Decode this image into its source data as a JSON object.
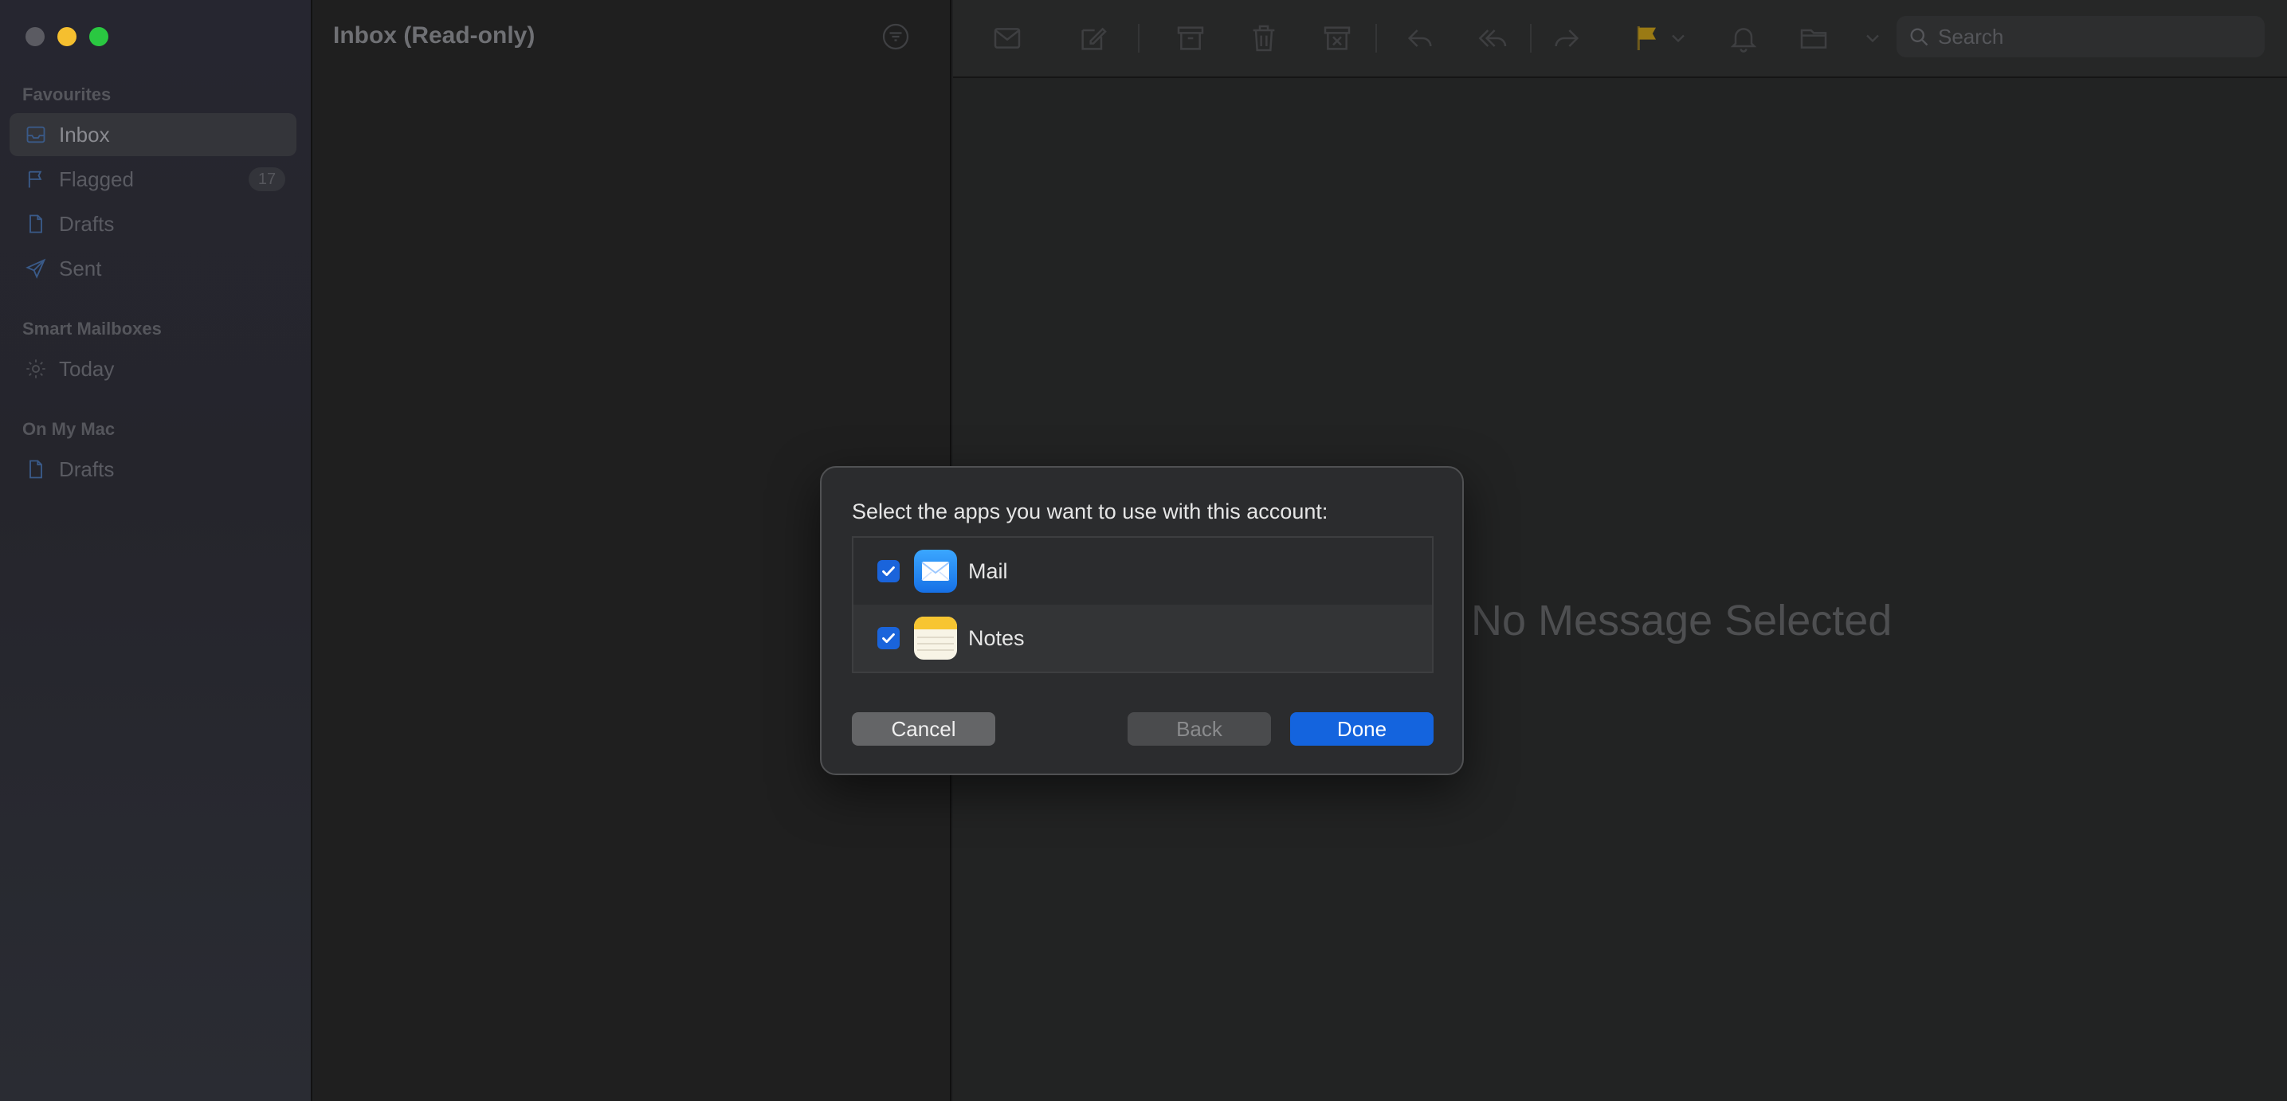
{
  "window": {
    "traffic_lights": [
      "close",
      "minimize",
      "maximize"
    ]
  },
  "sidebar": {
    "sections": [
      {
        "header": "Favourites"
      },
      {
        "header": "Smart Mailboxes"
      },
      {
        "header": "On My Mac"
      }
    ],
    "favourites": [
      {
        "label": "Inbox",
        "icon": "inbox-icon",
        "selected": true
      },
      {
        "label": "Flagged",
        "icon": "flag-icon",
        "badge": "17"
      },
      {
        "label": "Drafts",
        "icon": "document-icon"
      },
      {
        "label": "Sent",
        "icon": "paper-plane-icon"
      }
    ],
    "smart_mailboxes": [
      {
        "label": "Today",
        "icon": "gear-icon"
      }
    ],
    "on_my_mac": [
      {
        "label": "Drafts",
        "icon": "document-icon"
      }
    ]
  },
  "message_list": {
    "title": "Inbox (Read-only)"
  },
  "toolbar": {
    "search_placeholder": "Search",
    "flag_color": "#b8860b"
  },
  "content": {
    "empty_text": "No Message Selected"
  },
  "dialog": {
    "prompt": "Select the apps you want to use with this account:",
    "apps": [
      {
        "name": "Mail",
        "checked": true
      },
      {
        "name": "Notes",
        "checked": true
      }
    ],
    "buttons": {
      "cancel": "Cancel",
      "back": "Back",
      "done": "Done"
    },
    "accent_color": "#1464de"
  }
}
